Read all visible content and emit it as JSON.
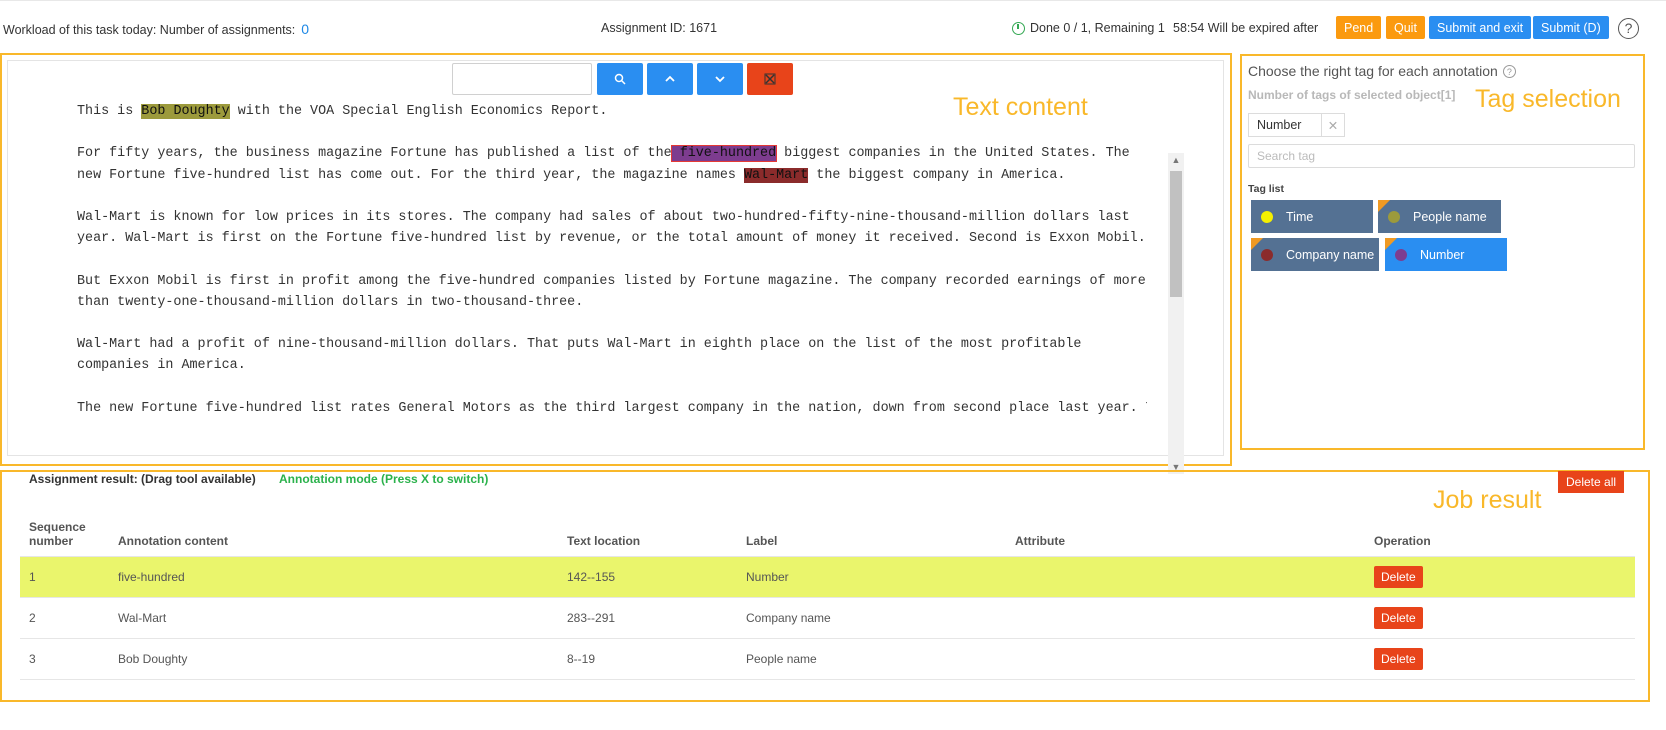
{
  "header": {
    "workload_label": "Workload of this task today: Number of assignments:",
    "workload_count": "0",
    "assignment_id": "Assignment ID: 1671",
    "progress": "Done 0 / 1, Remaining 1",
    "expire": "58:54 Will be expired after",
    "buttons": {
      "pend": "Pend",
      "quit": "Quit",
      "submit_exit": "Submit and exit",
      "submit": "Submit (D)"
    },
    "help": "?"
  },
  "text_panel": {
    "label": "Text content",
    "search_placeholder": "",
    "icons": [
      "search-icon",
      "chevron-up-icon",
      "chevron-down-icon",
      "close-icon"
    ],
    "paragraphs": [
      {
        "before": "This is ",
        "hl": "Bob Doughty",
        "after": " with the VOA Special English Economics Report."
      },
      {
        "before": "For fifty years, the business magazine Fortune has published a list of the",
        "hl": " five-hundred",
        "after": " biggest companies in the United States. The new Fortune five-hundred list has come out. For the third year, the magazine names ",
        "hl2": "Wal-Mart",
        "after2": " the biggest company in America."
      },
      {
        "text": "Wal-Mart is known for low prices in its stores. The company had sales of about two-hundred-fifty-nine-thousand-million dollars last year. Wal-Mart is first on the Fortune five-hundred list by revenue, or the total amount of money it received. Second is Exxon Mobil."
      },
      {
        "text": "But Exxon Mobil is first in profit among the five-hundred companies listed by Fortune magazine. The company recorded earnings of more than twenty-one-thousand-million dollars in two-thousand-three."
      },
      {
        "text": "Wal-Mart had a profit of nine-thousand-million dollars. That puts Wal-Mart in eighth place on the list of the most profitable companies in America."
      },
      {
        "text": "The new Fortune five-hundred list rates General Motors as the third largest company in the nation, down from second place last year. The"
      }
    ]
  },
  "tag_panel": {
    "label": "Tag selection",
    "title": "Choose the right tag for each annotation",
    "subtitle": "Number of tags of selected object[1]",
    "selected_tag": "Number",
    "search_placeholder": "Search tag",
    "list_label": "Tag list",
    "tags": [
      {
        "name": "Time",
        "dot": "#f5f000"
      },
      {
        "name": "People name",
        "dot": "#9c9a3c"
      },
      {
        "name": "Company name",
        "dot": "#8b2b2b"
      },
      {
        "name": "Number",
        "dot": "#7d3c8f"
      }
    ]
  },
  "result_panel": {
    "label": "Job result",
    "head": "Assignment result:  (Drag tool available)",
    "mode": "Annotation mode (Press X to switch)",
    "delete_all": "Delete all",
    "columns": [
      "Sequence number",
      "Annotation content",
      "Text location",
      "Label",
      "Attribute",
      "Operation"
    ],
    "rows": [
      {
        "seq": "1",
        "content": "five-hundred",
        "location": "142--155",
        "label": "Number",
        "attribute": "",
        "op": "Delete"
      },
      {
        "seq": "2",
        "content": "Wal-Mart",
        "location": "283--291",
        "label": "Company name",
        "attribute": "",
        "op": "Delete"
      },
      {
        "seq": "3",
        "content": "Bob Doughty",
        "location": "8--19",
        "label": "People name",
        "attribute": "",
        "op": "Delete"
      }
    ]
  }
}
